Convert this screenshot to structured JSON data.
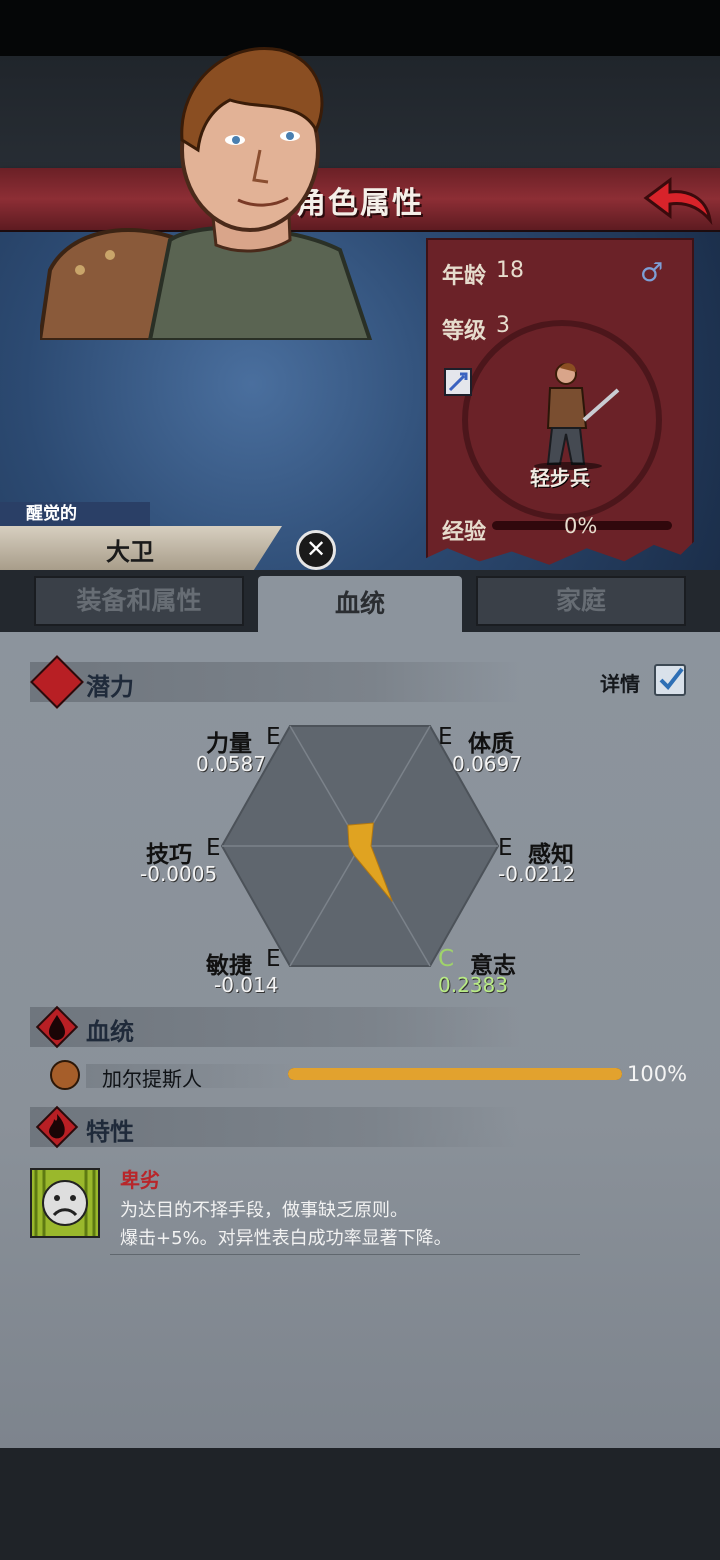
{
  "header": {
    "title": "角色属性"
  },
  "hero": {
    "adjective": "醒觉的",
    "name": "大卫",
    "age_label": "年龄",
    "age": "18",
    "level_label": "等级",
    "level": "3",
    "class_name": "轻步兵",
    "exp_label": "经验",
    "exp_percent": "0%",
    "exp_fraction": 0.0
  },
  "tabs": [
    {
      "label": "装备和属性"
    },
    {
      "label": "血统"
    },
    {
      "label": "家庭"
    }
  ],
  "potential": {
    "title": "潜力",
    "detail_label": "详情",
    "detail_checked": true,
    "stats": [
      {
        "name": "力量",
        "grade": "E",
        "value": "0.0587"
      },
      {
        "name": "体质",
        "grade": "E",
        "value": "0.0697"
      },
      {
        "name": "技巧",
        "grade": "E",
        "value": "-0.0005"
      },
      {
        "name": "感知",
        "grade": "E",
        "value": "-0.0212"
      },
      {
        "name": "敏捷",
        "grade": "E",
        "value": "-0.014"
      },
      {
        "name": "意志",
        "grade": "C",
        "value": "0.2383"
      }
    ]
  },
  "bloodline": {
    "title": "血统",
    "items": [
      {
        "name": "加尔提斯人",
        "percent": "100%",
        "fraction": 1.0
      }
    ]
  },
  "traits": {
    "title": "特性",
    "items": [
      {
        "name": "卑劣",
        "desc_line1": "为达目的不择手段，做事缺乏原则。",
        "desc_line2": "爆击+5%。对异性表白成功率显著下降。"
      }
    ]
  },
  "colors": {
    "title_bar": "#8d2e35",
    "grade_c": "#9fd36a",
    "bloodline_fill": "#e2a22e",
    "radar_fill": "#e0a321"
  },
  "icons": [
    "back-arrow-icon",
    "male-icon",
    "class-sword-icon",
    "close-icon",
    "potential-icon",
    "bloodline-drop-icon",
    "traits-flame-icon",
    "sad-face-icon",
    "checkbox-check-icon"
  ]
}
